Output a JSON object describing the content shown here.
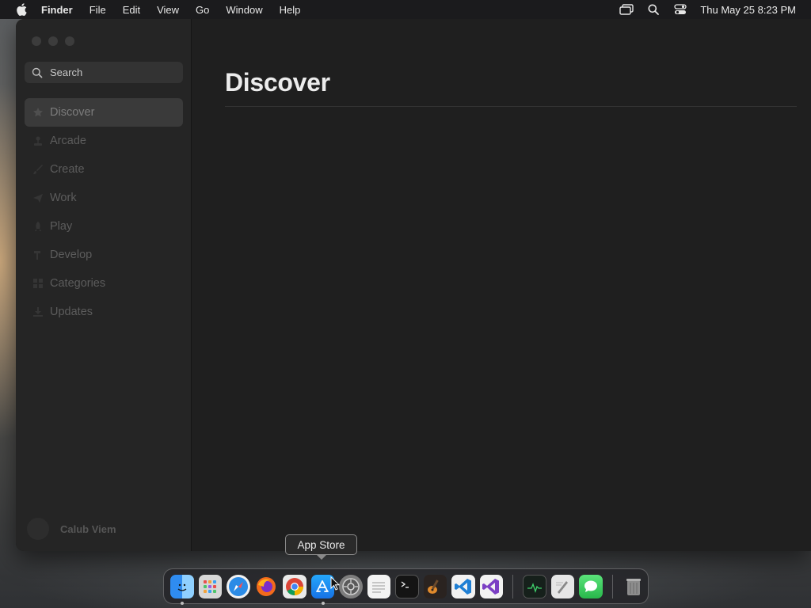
{
  "menubar": {
    "app_name": "Finder",
    "items": [
      "File",
      "Edit",
      "View",
      "Go",
      "Window",
      "Help"
    ],
    "clock": "Thu May 25  8:23 PM",
    "status_icons": [
      "screen-mirroring-icon",
      "spotlight-search-icon",
      "control-center-icon"
    ]
  },
  "window": {
    "search": {
      "placeholder": "Search"
    },
    "sidebar": {
      "items": [
        {
          "label": "Discover",
          "icon": "star-icon",
          "active": true
        },
        {
          "label": "Arcade",
          "icon": "joystick-icon",
          "active": false
        },
        {
          "label": "Create",
          "icon": "brush-icon",
          "active": false
        },
        {
          "label": "Work",
          "icon": "paperplane-icon",
          "active": false
        },
        {
          "label": "Play",
          "icon": "rocket-icon",
          "active": false
        },
        {
          "label": "Develop",
          "icon": "hammer-icon",
          "active": false
        },
        {
          "label": "Categories",
          "icon": "grid-icon",
          "active": false
        },
        {
          "label": "Updates",
          "icon": "download-icon",
          "active": false
        }
      ],
      "account_name": "Calub Viem"
    },
    "main": {
      "title": "Discover"
    }
  },
  "tooltip": {
    "label": "App Store"
  },
  "dock": {
    "apps": [
      {
        "name": "finder-icon",
        "color": "#2f8cf0",
        "running": true
      },
      {
        "name": "launchpad-icon",
        "color": "#dcdcdc",
        "running": false
      },
      {
        "name": "safari-icon",
        "color": "#2b8be6",
        "running": false
      },
      {
        "name": "firefox-icon",
        "color": "#f36b1c",
        "running": false
      },
      {
        "name": "chrome-icon",
        "color": "#e9e9e9",
        "running": false
      },
      {
        "name": "app-store-icon",
        "color": "#1d8cf2",
        "running": true
      },
      {
        "name": "system-settings-icon",
        "color": "#8a8a8a",
        "running": false
      },
      {
        "name": "textedit-icon",
        "color": "#f1f1f1",
        "running": false
      },
      {
        "name": "terminal-icon",
        "color": "#1b1b1b",
        "running": false
      },
      {
        "name": "garageband-icon",
        "color": "#3a2a20",
        "running": false
      },
      {
        "name": "vscode-icon",
        "color": "#1f7fd4",
        "running": false
      },
      {
        "name": "visual-studio-icon",
        "color": "#7b3fc4",
        "running": false
      },
      {
        "name": "activity-monitor-icon",
        "color": "#1e2a24",
        "running": false
      },
      {
        "name": "script-editor-icon",
        "color": "#e5e5e5",
        "running": false
      },
      {
        "name": "messages-icon",
        "color": "#34c759",
        "running": false
      },
      {
        "name": "trash-icon",
        "color": "#9a9a9a",
        "running": false
      }
    ]
  }
}
